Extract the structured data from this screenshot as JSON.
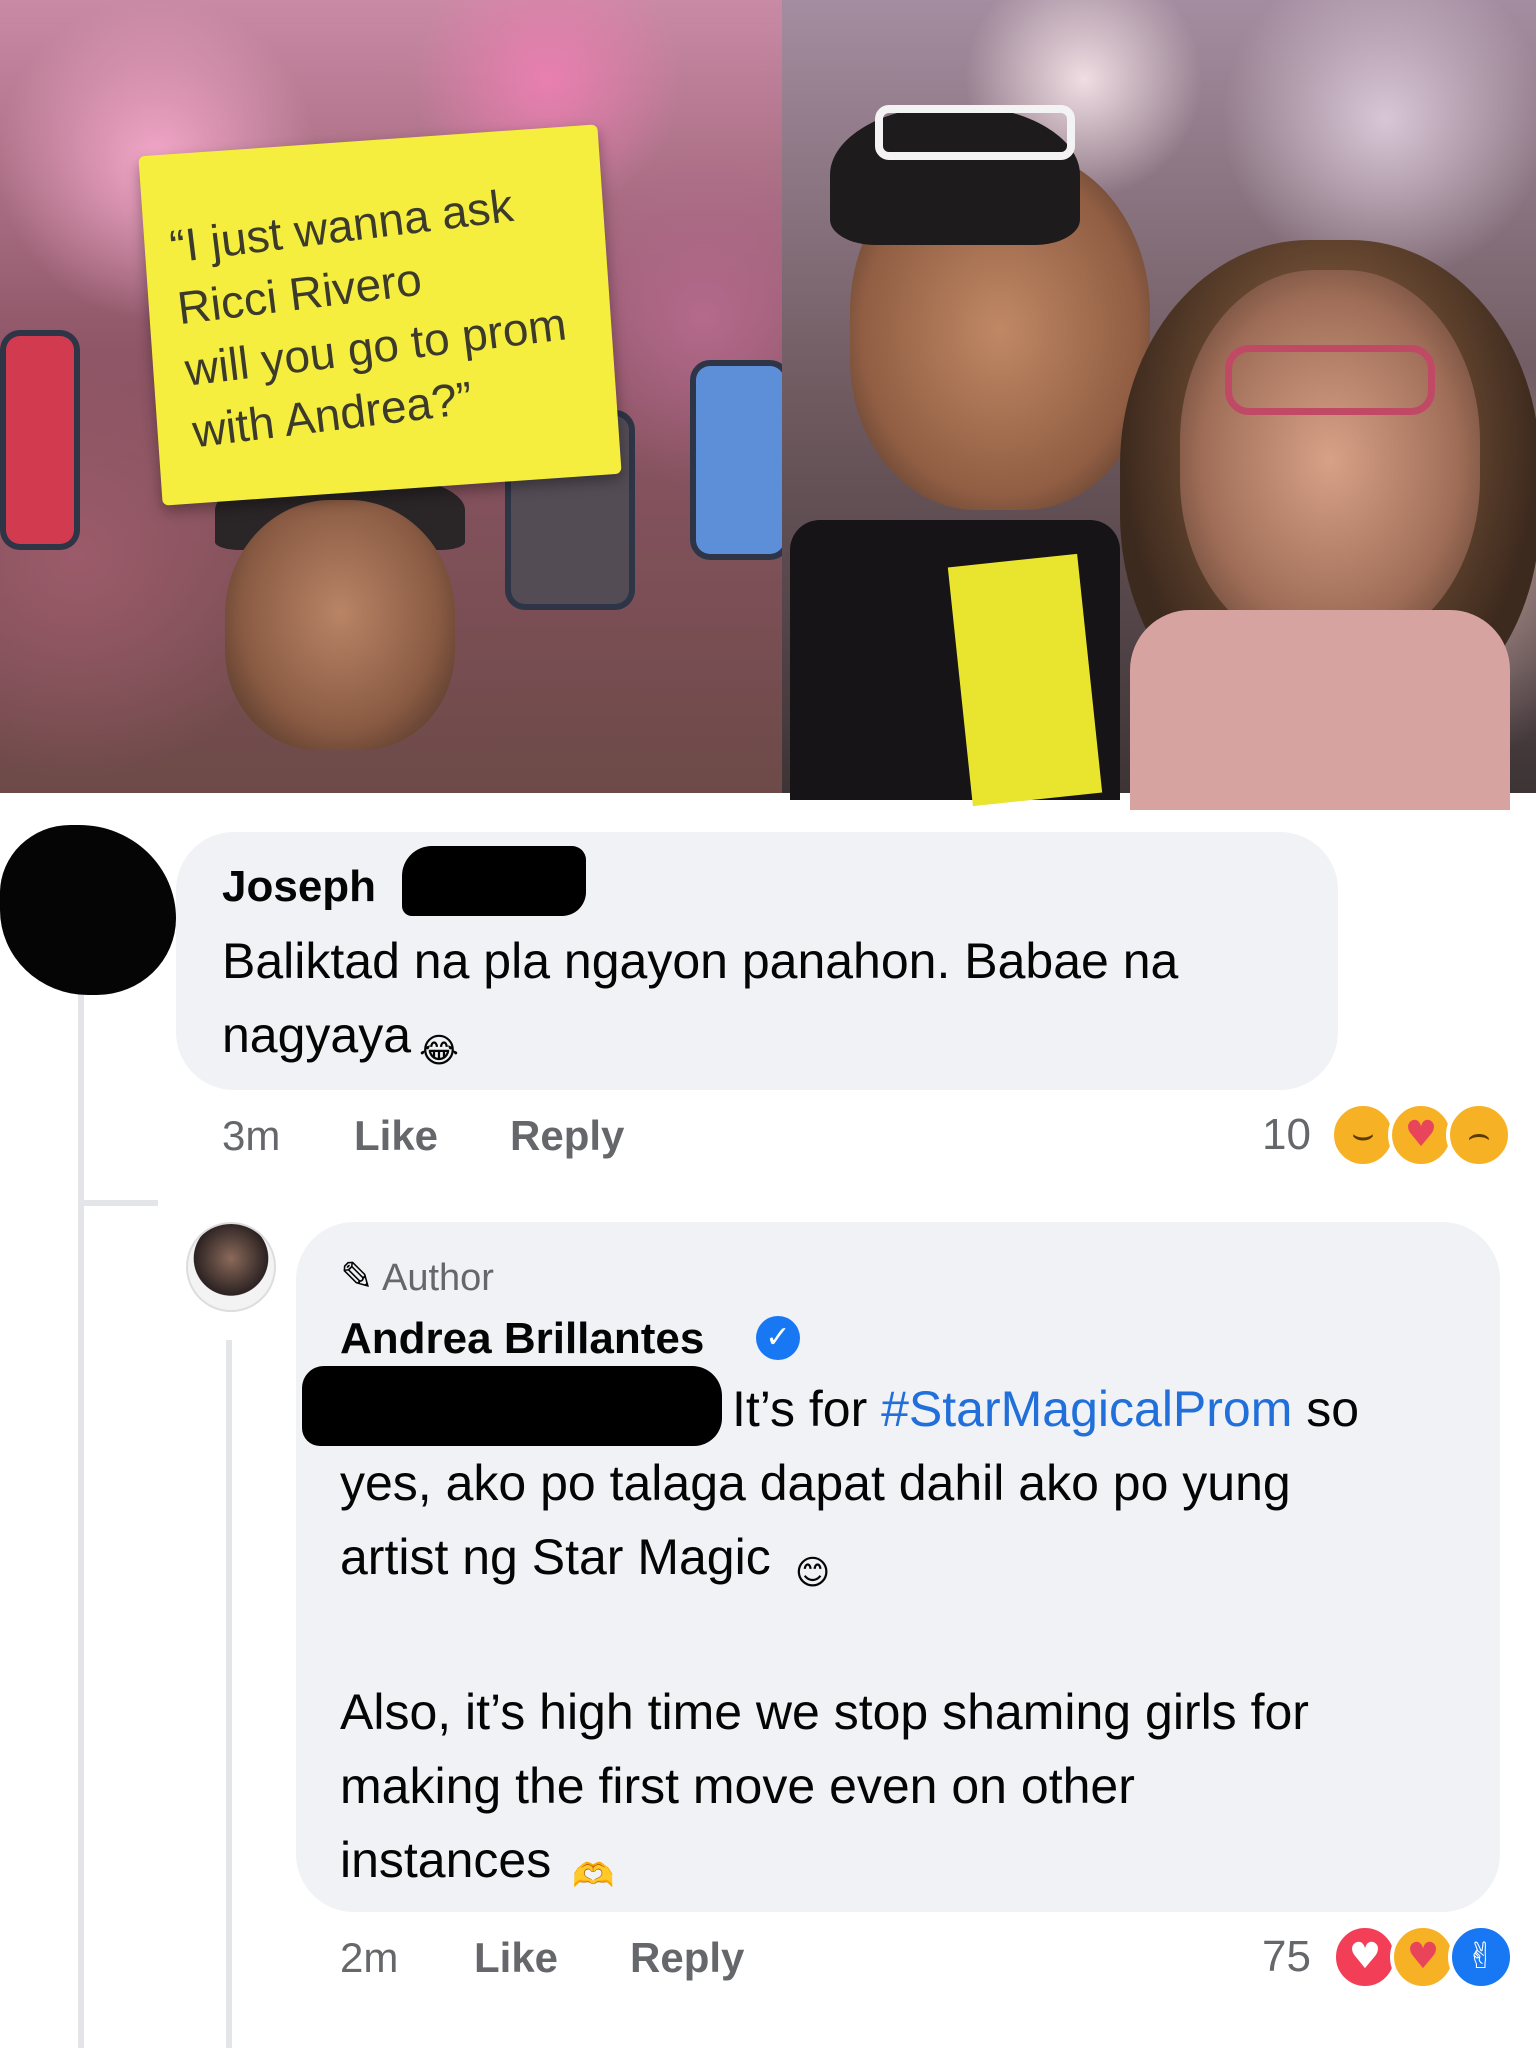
{
  "photo": {
    "sign_lines": [
      "“I just wanna ask",
      "Ricci Rivero",
      "will you go to prom",
      "with Andrea?”"
    ]
  },
  "comment1": {
    "name": "Joseph",
    "text_line1": "Baliktad na pla ngayon panahon. Babae na",
    "text_line2": "nagyaya",
    "emoji": "😂",
    "time": "3m",
    "like_label": "Like",
    "reply_label": "Reply",
    "reaction_count": "10",
    "reactions": [
      "haha-icon",
      "care-icon",
      "sad-icon"
    ]
  },
  "comment2": {
    "badge": "Author",
    "name": "Andrea Brillantes",
    "line1_prefix": "It’s for ",
    "hashtag": "#StarMagicalProm",
    "line1_suffix": " so",
    "line2": "yes, ako po talaga dapat dahil ako po yung",
    "line3": "artist ng Star Magic",
    "emoji_smile": "😊",
    "para2_line1": "Also, it’s high time we stop shaming girls for",
    "para2_line2": "making the first move even on other",
    "para2_line3": "instances",
    "emoji_heart_hands": "🫶",
    "time": "2m",
    "like_label": "Like",
    "reply_label": "Reply",
    "reaction_count": "75",
    "reactions": [
      "love-icon",
      "care-icon",
      "like-icon"
    ]
  },
  "colors": {
    "bubble": "#f0f2f5",
    "meta": "#65676b",
    "hashtag": "#216fdb",
    "verified": "#1877f2"
  }
}
